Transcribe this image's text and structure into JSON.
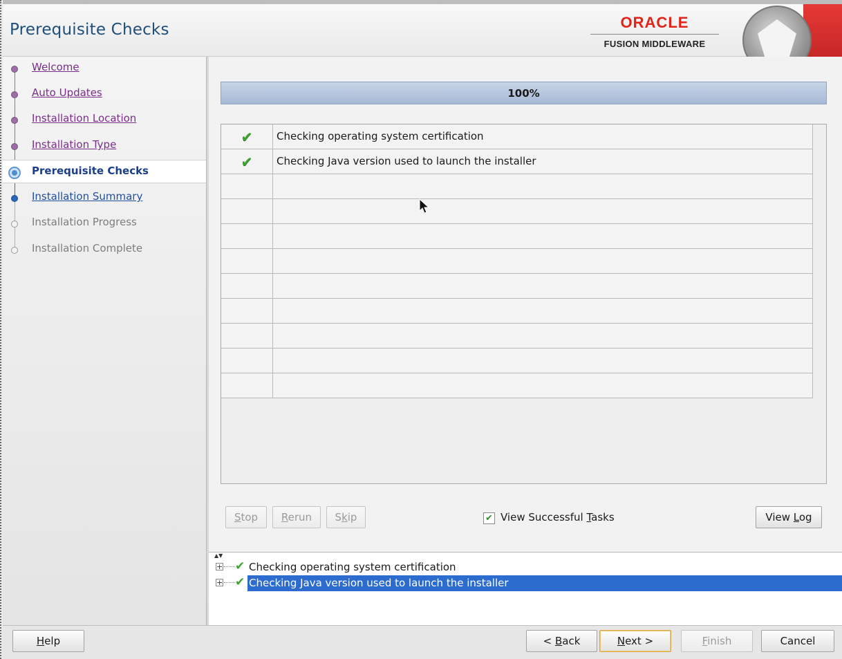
{
  "header": {
    "title": "Prerequisite Checks",
    "brand_name": "ORACLE",
    "brand_product": "FUSION MIDDLEWARE"
  },
  "nav": {
    "items": [
      {
        "label": "Welcome",
        "state": "visited"
      },
      {
        "label": "Auto Updates",
        "state": "visited"
      },
      {
        "label": "Installation Location",
        "state": "visited"
      },
      {
        "label": "Installation Type",
        "state": "visited"
      },
      {
        "label": "Prerequisite Checks",
        "state": "current"
      },
      {
        "label": "Installation Summary",
        "state": "next"
      },
      {
        "label": "Installation Progress",
        "state": "disabled"
      },
      {
        "label": "Installation Complete",
        "state": "disabled"
      }
    ]
  },
  "progress": {
    "label": "100%",
    "percent": 100
  },
  "tasks": {
    "rows": [
      {
        "status_icon": "check-icon",
        "text": "Checking operating system certification"
      },
      {
        "status_icon": "check-icon",
        "text": "Checking Java version used to launch the installer"
      }
    ],
    "empty_row_count": 9
  },
  "task_buttons": {
    "stop": {
      "pre": "",
      "mn": "S",
      "post": "top"
    },
    "rerun": {
      "pre": "",
      "mn": "R",
      "post": "erun"
    },
    "skip": {
      "pre": "S",
      "mn": "k",
      "post": "ip"
    },
    "view_successful": {
      "pre": "View Successful ",
      "mn": "T",
      "post": "asks",
      "checked": true
    },
    "view_log": {
      "pre": "View ",
      "mn": "L",
      "post": "og"
    }
  },
  "log": {
    "expander_symbol": "+",
    "rows": [
      {
        "status_icon": "check-icon",
        "text": "Checking operating system certification",
        "selected": false
      },
      {
        "status_icon": "check-icon",
        "text": "Checking Java version used to launch the installer",
        "selected": true
      }
    ]
  },
  "footer": {
    "help": {
      "pre": "",
      "mn": "H",
      "post": "elp"
    },
    "back": {
      "pre": "< ",
      "mn": "B",
      "post": "ack"
    },
    "next": {
      "pre": "",
      "mn": "N",
      "post": "ext >"
    },
    "finish": {
      "pre": "",
      "mn": "F",
      "post": "inish"
    },
    "cancel": {
      "pre": "Cancel",
      "mn": "",
      "post": ""
    }
  },
  "colors": {
    "title": "#1f4e79",
    "brand_red": "#e2231a",
    "check_green": "#3ea331",
    "selection_blue": "#2d6ccf"
  }
}
